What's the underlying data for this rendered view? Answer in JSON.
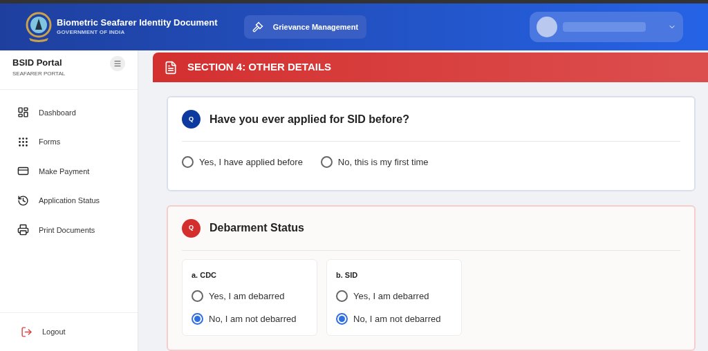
{
  "header": {
    "title": "Biometric Seafarer Identity Document",
    "subtitle": "GOVERNMENT OF INDIA",
    "grievance_button": "Grievance Management"
  },
  "sidebar": {
    "title": "BSID Portal",
    "subtitle": "SEAFARER PORTAL",
    "items": [
      {
        "label": "Dashboard"
      },
      {
        "label": "Forms"
      },
      {
        "label": "Make Payment"
      },
      {
        "label": "Application Status"
      },
      {
        "label": "Print Documents"
      }
    ],
    "logout": "Logout"
  },
  "section": {
    "title": "SECTION 4: OTHER DETAILS"
  },
  "questions": [
    {
      "badge": "Q",
      "color": "#0d3a9e",
      "kind": "radio",
      "title": "Have you ever applied for SID before?",
      "options": [
        {
          "label": "Yes, I have applied before",
          "selected": false
        },
        {
          "label": "No, this is my first time",
          "selected": false
        }
      ]
    },
    {
      "badge": "Q",
      "color": "#d32f2f",
      "kind": "groups",
      "title": "Debarment Status",
      "groups": [
        {
          "label": "a. CDC",
          "options": [
            {
              "label": "Yes, I am debarred",
              "selected": false
            },
            {
              "label": "No, I am not debarred",
              "selected": true
            }
          ]
        },
        {
          "label": "b. SID",
          "options": [
            {
              "label": "Yes, I am debarred",
              "selected": false
            },
            {
              "label": "No, I am not debarred",
              "selected": true
            }
          ]
        }
      ]
    }
  ]
}
